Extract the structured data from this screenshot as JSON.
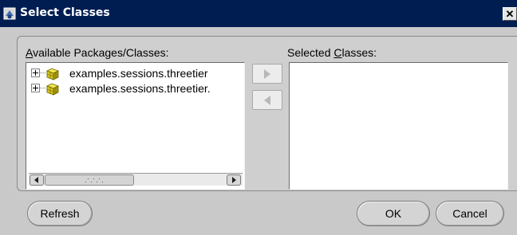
{
  "window": {
    "title": "Select Classes",
    "close_glyph": "✕"
  },
  "available": {
    "label_mnemonic": "A",
    "label_rest": "vailable Packages/Classes:",
    "items": [
      {
        "label": "examples.sessions.threetier",
        "icon": "package-icon",
        "expander": "expand-plus-icon"
      },
      {
        "label": "examples.sessions.threetier.",
        "icon": "package-icon",
        "expander": "expand-plus-icon"
      }
    ]
  },
  "selected": {
    "label_pre": "Selected ",
    "label_mnemonic": "C",
    "label_post": "lasses:",
    "items": []
  },
  "move_buttons": {
    "add_icon": "arrow-right-icon",
    "remove_icon": "arrow-left-icon"
  },
  "buttons": {
    "refresh": "Refresh",
    "ok": "OK",
    "cancel": "Cancel"
  }
}
